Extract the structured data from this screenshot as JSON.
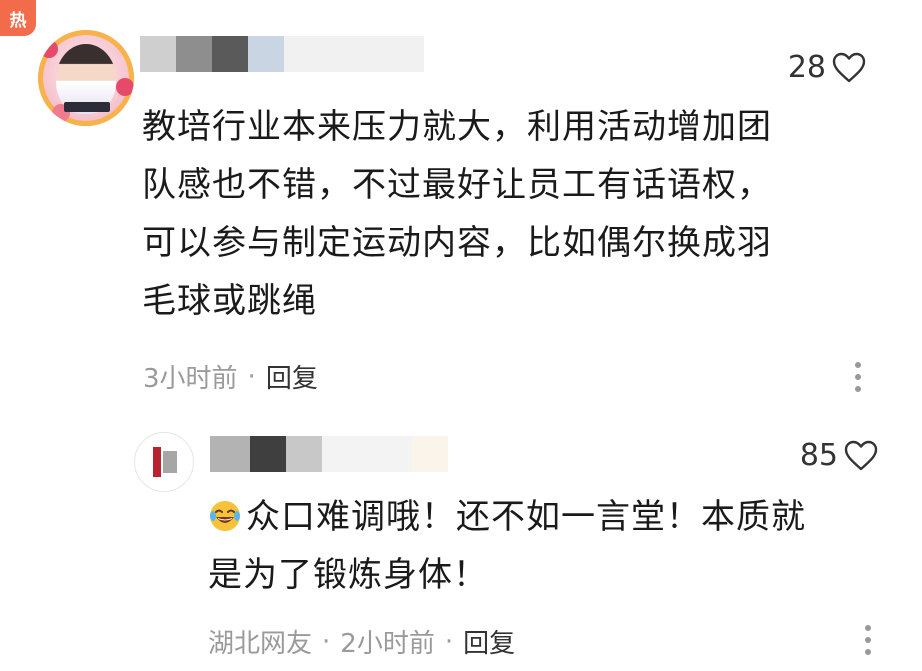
{
  "comments": [
    {
      "badge": "热",
      "likes": "28",
      "text_lines": [
        "教培行业本来压力就大，利用活动增加团",
        "队感也不错，不过最好让员工有话语权，",
        "可以参与制定运动内容，比如偶尔换成羽",
        "毛球或跳绳"
      ],
      "time": "3小时前",
      "separator": "·",
      "reply_label": "回复",
      "icons": {
        "like": "heart-outline-icon",
        "more": "more-vertical-icon"
      }
    },
    {
      "likes": "85",
      "emoji": "laughing-tears-emoji",
      "text_lines": [
        "众口难调哦！还不如一言堂！本质就",
        "是为了锻炼身体！"
      ],
      "location": "湖北网友",
      "separator": "·",
      "time": "2小时前",
      "separator2": "·",
      "reply_label": "回复",
      "icons": {
        "like": "heart-outline-icon",
        "more": "more-vertical-icon"
      }
    }
  ],
  "colors": {
    "badge": "#f26b4b",
    "meta_text": "#9a9a9a",
    "body_text": "#1a1a1a"
  }
}
